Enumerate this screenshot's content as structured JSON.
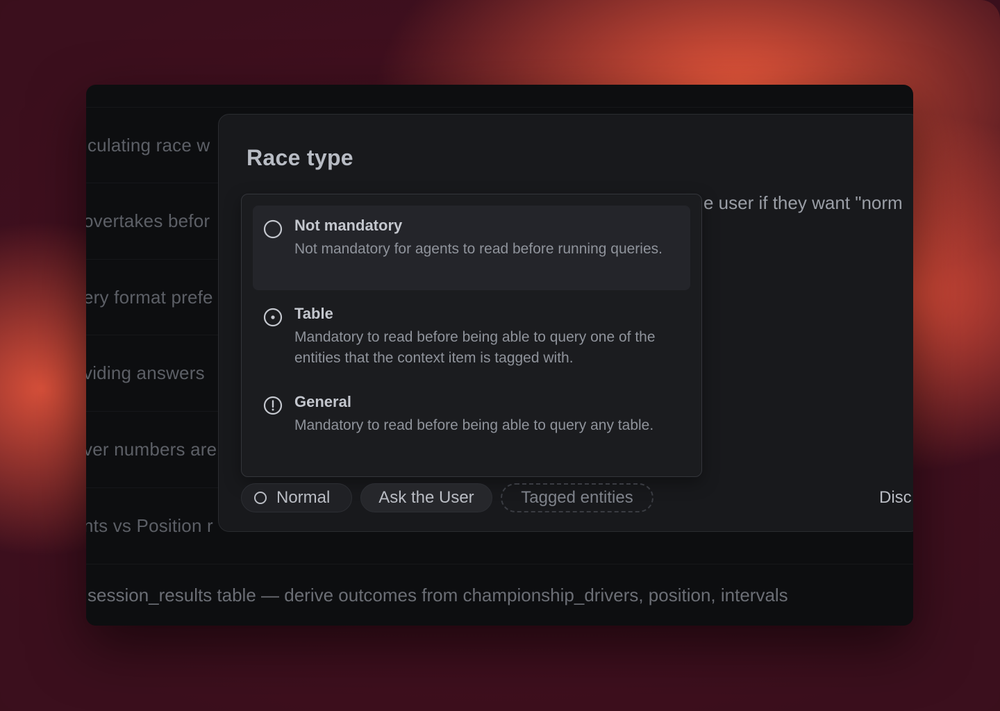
{
  "background_rows": [
    "iculating race w",
    "overtakes befor",
    "ery format prefe",
    "viding answers",
    "ver numbers are",
    "nts vs Position r"
  ],
  "bottom_row_text": "session_results table — derive outcomes from championship_drivers, position, intervals",
  "panel": {
    "title": "Race type",
    "side_text": "e user if they want \"norm",
    "options": [
      {
        "icon": "circle-outline-icon",
        "title": "Not mandatory",
        "description": "Not mandatory for agents to read before running queries.",
        "highlighted": true
      },
      {
        "icon": "circle-dot-icon",
        "title": "Table",
        "description": "Mandatory to read before being able to query one of the entities that the context item is tagged with.",
        "highlighted": false
      },
      {
        "icon": "alert-circle-icon",
        "title": "General",
        "description": "Mandatory to read before being able to query any table.",
        "highlighted": false
      }
    ],
    "chips": {
      "normal": "Normal",
      "ask_user": "Ask the User",
      "tagged_entities": "Tagged entities"
    },
    "discard_label": "Disc"
  },
  "colors": {
    "window_bg": "#0d0e10",
    "panel_bg": "#18191c",
    "backdrop_accent": "#ef5a3c"
  }
}
